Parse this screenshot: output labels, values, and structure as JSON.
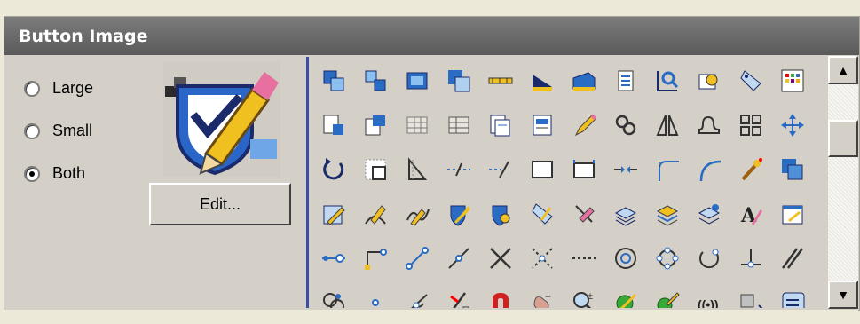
{
  "header": {
    "title": "Button Image"
  },
  "size_options": [
    {
      "label": "Large",
      "checked": false
    },
    {
      "label": "Small",
      "checked": false
    },
    {
      "label": "Both",
      "checked": true
    }
  ],
  "edit_button": {
    "label": "Edit..."
  },
  "scrollbar": {
    "up_glyph": "▲",
    "down_glyph": "▼"
  },
  "colors": {
    "header": "#6b6b6b",
    "panel": "#d4d0c8",
    "grid_border": "#3a4fa0",
    "icon_blue": "#2a6cc4",
    "icon_dark": "#1a2a6a",
    "icon_yellow": "#f0c020",
    "icon_green": "#38a838"
  },
  "icons": [
    "copy-layers-icon",
    "move-layers-icon",
    "window-layers-icon",
    "overlap-layers-icon",
    "ruler-icon",
    "slope-fill-icon",
    "3d-slab-icon",
    "checklist-icon",
    "zoom-chart-icon",
    "object-search-icon",
    "tag-icon",
    "color-palette-icon",
    "block-edit-icon",
    "block-insert-icon",
    "grid-table-icon",
    "grid-table-alt-icon",
    "documents-icon",
    "report-icon",
    "pencil-edit-icon",
    "link-chain-icon",
    "mirror-icon",
    "rounded-shape-icon",
    "grid-array-icon",
    "move-cross-icon",
    "rotate-icon",
    "scale-icon",
    "triangle-icon",
    "extend-line-icon",
    "trim-line-icon",
    "rectangle-icon",
    "rectangle-alt-icon",
    "break-line-icon",
    "fillet-icon",
    "arc-icon",
    "magic-wand-icon",
    "stack-icon",
    "edit-drawing-icon",
    "pencil-curve-icon",
    "pencil-wave-icon",
    "shield-edit-icon",
    "shield-pin-icon",
    "tag-edit-icon",
    "pencil-cross-icon",
    "layers-icon",
    "layers-yellow-icon",
    "layers-star-icon",
    "text-style-icon",
    "dialog-edit-icon",
    "line-node-icon",
    "corner-node-icon",
    "diagonal-node-icon",
    "diagonal-line-icon",
    "cross-x-icon",
    "cross-dashed-icon",
    "dashed-line-icon",
    "circle-target-icon",
    "circle-nodes-icon",
    "circle-arc-icon",
    "perpendicular-icon",
    "parallel-icon",
    "snap-group-icon",
    "point-icon",
    "angle-node-icon",
    "erase-node-icon",
    "magnet-icon",
    "hand-add-icon",
    "zoom-in-icon",
    "green-ball-icon",
    "green-ball-pen-icon",
    "radio-waves-icon",
    "pen-export-icon",
    "scroll-paper-icon"
  ]
}
